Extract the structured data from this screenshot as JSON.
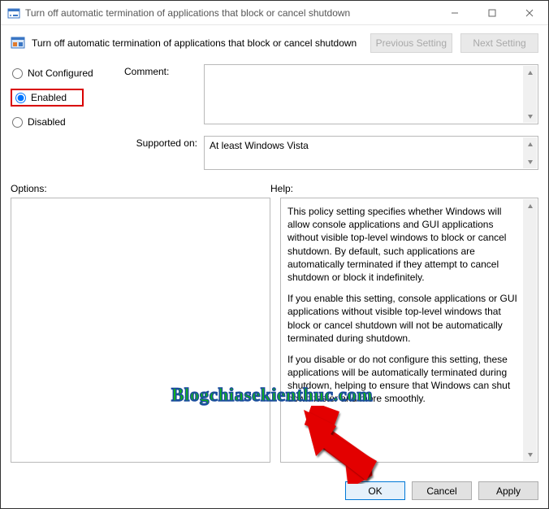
{
  "window": {
    "title": "Turn off automatic termination of applications that block or cancel shutdown"
  },
  "policy": {
    "title": "Turn off automatic termination of applications that block or cancel shutdown",
    "nav": {
      "previous": "Previous Setting",
      "next": "Next Setting"
    }
  },
  "state": {
    "not_configured": "Not Configured",
    "enabled": "Enabled",
    "disabled": "Disabled",
    "selected": "enabled"
  },
  "labels": {
    "comment": "Comment:",
    "supported_on": "Supported on:",
    "options": "Options:",
    "help": "Help:"
  },
  "fields": {
    "comment": "",
    "supported_on": "At least Windows Vista"
  },
  "help": {
    "p1": "This policy setting specifies whether Windows will allow console applications and GUI applications without visible top-level windows to block or cancel shutdown. By default, such applications are automatically terminated if they attempt to cancel shutdown or block it indefinitely.",
    "p2": "If you enable this setting, console applications or GUI applications without visible top-level windows that block or cancel shutdown will not be automatically terminated during shutdown.",
    "p3": "If you disable or do not configure this setting, these applications will be automatically terminated during shutdown, helping to ensure that Windows can shut down faster and more smoothly."
  },
  "buttons": {
    "ok": "OK",
    "cancel": "Cancel",
    "apply": "Apply"
  },
  "watermark": "Blogchiasekienthuc.com"
}
